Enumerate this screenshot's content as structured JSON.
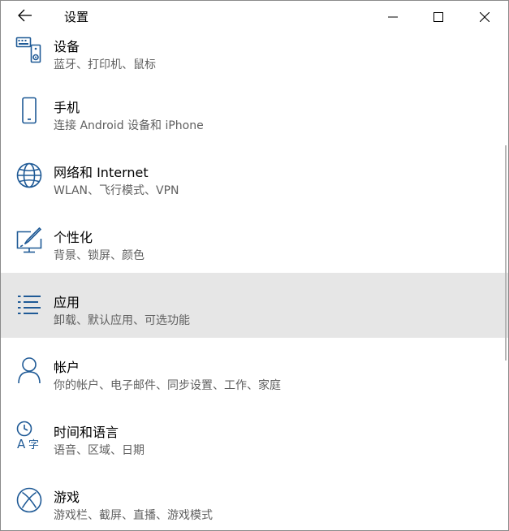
{
  "window": {
    "title": "设置"
  },
  "settings": {
    "items": [
      {
        "title": "设备",
        "description": "蓝牙、打印机、鼠标",
        "icon": "device-icon"
      },
      {
        "title": "手机",
        "description": "连接 Android 设备和 iPhone",
        "icon": "phone-icon"
      },
      {
        "title": "网络和 Internet",
        "description": "WLAN、飞行模式、VPN",
        "icon": "globe-icon"
      },
      {
        "title": "个性化",
        "description": "背景、锁屏、颜色",
        "icon": "personalization-icon"
      },
      {
        "title": "应用",
        "description": "卸载、默认应用、可选功能",
        "icon": "apps-list-icon",
        "selected": true
      },
      {
        "title": "帐户",
        "description": "你的帐户、电子邮件、同步设置、工作、家庭",
        "icon": "person-icon"
      },
      {
        "title": "时间和语言",
        "description": "语音、区域、日期",
        "icon": "time-language-icon"
      },
      {
        "title": "游戏",
        "description": "游戏栏、截屏、直播、游戏模式",
        "icon": "xbox-icon"
      }
    ]
  },
  "colors": {
    "selected_background": "#e6e6e6",
    "accent": "#1f5a96",
    "secondary_text": "#5f5f5f"
  }
}
